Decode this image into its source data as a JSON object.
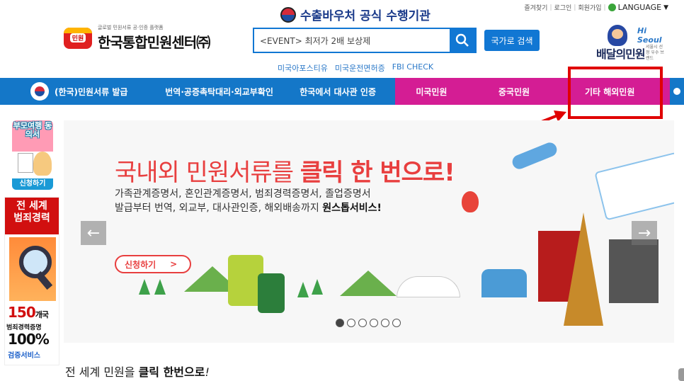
{
  "topnav": {
    "links": [
      "즐겨찾기",
      "로그인",
      "회원가입"
    ],
    "language": "LANGUAGE"
  },
  "header": {
    "gov_badge": "수출바우처 공식 수행기관",
    "logo_sub": "글로벌 민원서류 공·인증 플랫폼",
    "logo_badge": "민원",
    "logo_main": "한국통합민원센터㈜",
    "search_value": "<EVENT> 최저가 2배 보상제",
    "country_search": "국가로 검색",
    "quick_links": [
      "미국아포스티유",
      "미국운전면허증",
      "FBI CHECK"
    ],
    "brand": {
      "hi": "Hi Seoul",
      "name": "배달의민원",
      "sub": "서울시 선정 우수 브랜드"
    }
  },
  "mainnav": {
    "items": [
      "(한국)민원서류 발급",
      "번역·공증촉탁대리·외교부확인",
      "한국에서 대사관 인증",
      "미국민원",
      "중국민원",
      "기타 해외민원"
    ]
  },
  "side": {
    "banner1_title": "부모여행 동의서",
    "banner1_cta": "신청하기",
    "banner2_top1": "전 세계",
    "banner2_top2": "범죄경력",
    "banner2_count": "150",
    "banner2_count_unit": "개국",
    "banner2_line": "범죄경력증명",
    "banner2_pct": "100%",
    "banner2_service": "검증서비스"
  },
  "hero": {
    "headline_a": "국내외 민원서류를 ",
    "headline_b": "클릭 한 번으로!",
    "desc_line1": "가족관계증명서, 혼인관계증명서, 범죄경력증명서, 졸업증명서",
    "desc_line2_a": "발급부터 번역, 외교부, 대사관인증, 해외배송까지 ",
    "desc_line2_b": "원스톱서비스!",
    "cta": "신청하기",
    "cta_arrow": ">",
    "prev": "←",
    "next": "→",
    "slides_count": 6,
    "active_slide": 1
  },
  "footer_title_a": "전 세계 민원을 ",
  "footer_title_b": "클릭 한번으로",
  "footer_title_c": "!",
  "colors": {
    "nav_blue": "#1477c8",
    "nav_magenta": "#d41d94",
    "highlight_red": "#e00000",
    "brand_red": "#e83f3f"
  }
}
